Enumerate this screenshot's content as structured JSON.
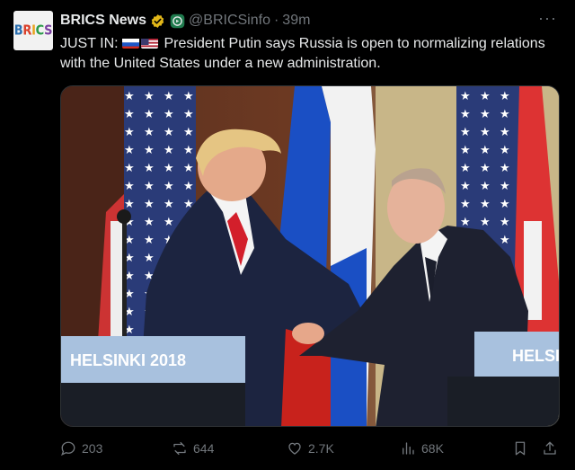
{
  "post": {
    "author": {
      "name": "BRICS News",
      "avatar_text": "BRICS",
      "handle": "@BRICSinfo",
      "separator": "·",
      "time": "39m"
    },
    "more_icon": "more-dots-icon",
    "text_prefix": "JUST IN: ",
    "text_body": " President Putin says Russia is open to normalizing relations with the United States under a new administration.",
    "flags": [
      "russia-flag",
      "usa-flag"
    ],
    "media": {
      "podium_left_text": "HELSINKI 2018",
      "podium_right_text": "HELSI"
    },
    "actions": {
      "replies": "203",
      "reposts": "644",
      "likes": "2.7K",
      "views": "68K"
    },
    "colors": {
      "background": "#000000",
      "text": "#e7e9ea",
      "muted": "#71767b",
      "verified_gold": "#e2b719",
      "affiliate_green": "#00ba7c"
    }
  }
}
